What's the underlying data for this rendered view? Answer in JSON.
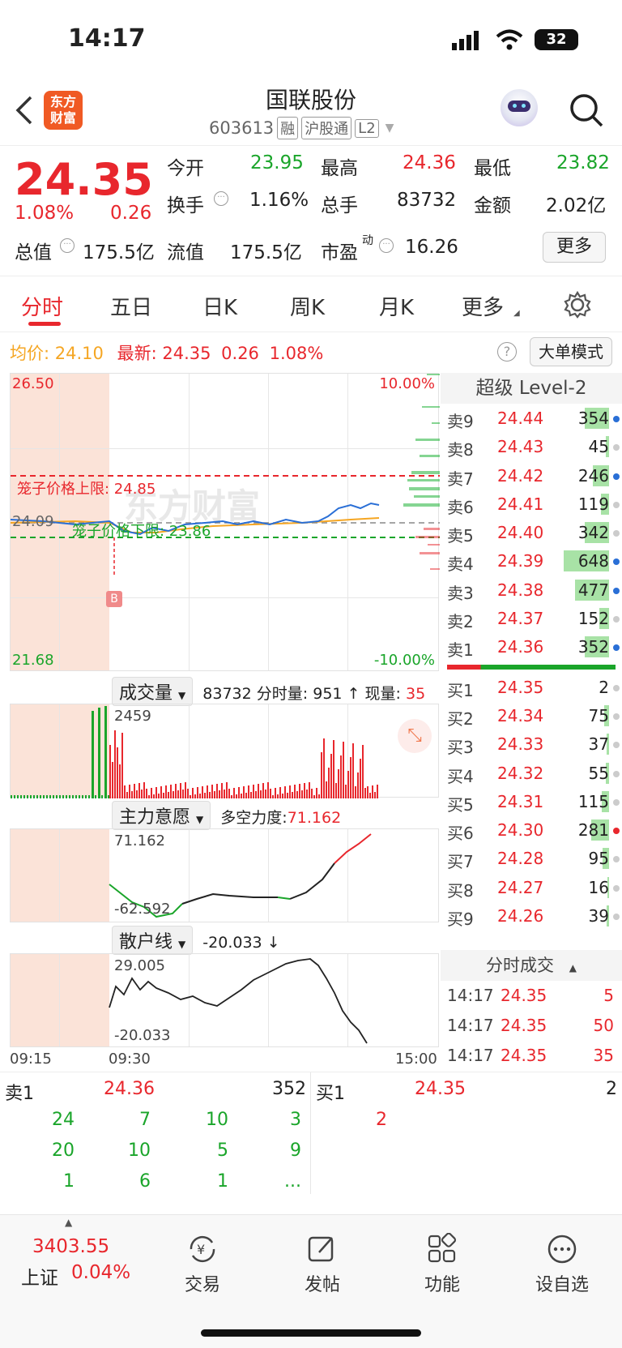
{
  "status": {
    "time": "14:17",
    "battery": "32"
  },
  "header": {
    "title": "国联股份",
    "code": "603613",
    "tags": [
      "融",
      "沪股通",
      "L2"
    ],
    "brand": "东方\n财富"
  },
  "quote": {
    "price": "24.35",
    "pct": "1.08%",
    "chg": "0.26",
    "open_label": "今开",
    "open": "23.95",
    "high_label": "最高",
    "high": "24.36",
    "low_label": "最低",
    "low": "23.82",
    "turnover_label": "换手",
    "turnover": "1.16%",
    "volume_label": "总手",
    "volume": "83732",
    "amount_label": "金额",
    "amount": "2.02亿",
    "mcap_label": "总值",
    "mcap": "175.5亿",
    "float_label": "流值",
    "float": "175.5亿",
    "pe_label": "市盈",
    "pe_sup": "动",
    "pe": "16.26",
    "more": "更多"
  },
  "tabs": [
    "分时",
    "五日",
    "日K",
    "周K",
    "月K",
    "更多"
  ],
  "info": {
    "avg_label": "均价:",
    "avg": "24.10",
    "latest_label": "最新:",
    "latest": "24.35",
    "chg": "0.26",
    "pct": "1.08%",
    "mode_btn": "大单模式"
  },
  "price_chart": {
    "top": "26.50",
    "bottom": "21.68",
    "pct_top": "10.00%",
    "pct_bottom": "-10.00%",
    "prev_close": "24.09",
    "upper_limit": "笼子价格上限: 24.85",
    "lower_limit": "笼子价格下限: 23.86",
    "watermark": "东方财富",
    "marker": "B"
  },
  "volume": {
    "dropdown": "成交量",
    "total": "83732",
    "tick_label": "分时量:",
    "tick": "951",
    "arrow": "↑",
    "now_label": "现量:",
    "now": "35",
    "max": "2459"
  },
  "main_force": {
    "dropdown": "主力意愿",
    "label": "多空力度:",
    "value": "71.162",
    "max": "71.162",
    "min": "-62.592"
  },
  "retail": {
    "dropdown": "散户线",
    "value": "-20.033",
    "arrow": "↓",
    "max": "29.005",
    "min": "-20.033",
    "t_start": "09:15",
    "t_mid": "09:30",
    "t_end": "15:00"
  },
  "orderbook": {
    "title": "超级 Level-2",
    "asks": [
      {
        "n": "卖9",
        "p": "24.44",
        "v": "354",
        "w": 30,
        "dot": "#2a6fd6"
      },
      {
        "n": "卖8",
        "p": "24.43",
        "v": "45",
        "w": 4,
        "dot": "#ccc"
      },
      {
        "n": "卖7",
        "p": "24.42",
        "v": "246",
        "w": 20,
        "dot": "#2a6fd6"
      },
      {
        "n": "卖6",
        "p": "24.41",
        "v": "119",
        "w": 10,
        "dot": "#ccc"
      },
      {
        "n": "卖5",
        "p": "24.40",
        "v": "342",
        "w": 30,
        "dot": "#ccc"
      },
      {
        "n": "卖4",
        "p": "24.39",
        "v": "648",
        "w": 56,
        "dot": "#2a6fd6"
      },
      {
        "n": "卖3",
        "p": "24.38",
        "v": "477",
        "w": 42,
        "dot": "#2a6fd6"
      },
      {
        "n": "卖2",
        "p": "24.37",
        "v": "152",
        "w": 12,
        "dot": "#ccc"
      },
      {
        "n": "卖1",
        "p": "24.36",
        "v": "352",
        "w": 30,
        "dot": "#2a6fd6"
      }
    ],
    "bids": [
      {
        "n": "买1",
        "p": "24.35",
        "v": "2",
        "w": 0,
        "dot": "#ccc"
      },
      {
        "n": "买2",
        "p": "24.34",
        "v": "75",
        "w": 6,
        "dot": "#ccc"
      },
      {
        "n": "买3",
        "p": "24.33",
        "v": "37",
        "w": 3,
        "dot": "#ccc"
      },
      {
        "n": "买4",
        "p": "24.32",
        "v": "55",
        "w": 4,
        "dot": "#ccc"
      },
      {
        "n": "买5",
        "p": "24.31",
        "v": "115",
        "w": 9,
        "dot": "#ccc"
      },
      {
        "n": "买6",
        "p": "24.30",
        "v": "281",
        "w": 22,
        "dot": "#e8272d"
      },
      {
        "n": "买7",
        "p": "24.28",
        "v": "95",
        "w": 8,
        "dot": "#ccc"
      },
      {
        "n": "买8",
        "p": "24.27",
        "v": "16",
        "w": 2,
        "dot": "#ccc"
      },
      {
        "n": "买9",
        "p": "24.26",
        "v": "39",
        "w": 3,
        "dot": "#ccc"
      }
    ],
    "ticks_title": "分时成交",
    "trades": [
      {
        "t": "14:17",
        "p": "24.35",
        "v": "5"
      },
      {
        "t": "14:17",
        "p": "24.35",
        "v": "50"
      },
      {
        "t": "14:17",
        "p": "24.35",
        "v": "35"
      }
    ]
  },
  "queue": {
    "ask_label": "卖1",
    "ask_price": "24.36",
    "ask_total": "352",
    "bid_label": "买1",
    "bid_price": "24.35",
    "bid_total": "2",
    "ask_rows": [
      [
        "24",
        "7",
        "10",
        "3"
      ],
      [
        "20",
        "10",
        "5",
        "9"
      ],
      [
        "1",
        "6",
        "1",
        "..."
      ]
    ],
    "bid_rows": [
      [
        "2"
      ]
    ]
  },
  "bottom": {
    "index": "3403.55",
    "index_name": "上证",
    "index_pct": "0.04%",
    "nav": [
      "交易",
      "发帖",
      "功能",
      "设自选"
    ]
  }
}
